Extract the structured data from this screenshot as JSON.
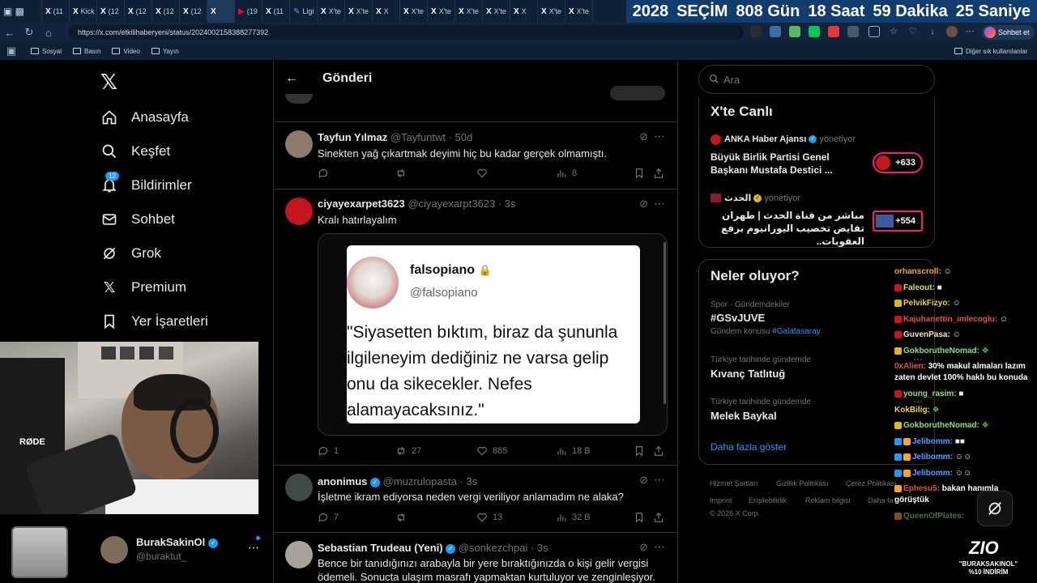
{
  "browser": {
    "tabs": [
      {
        "favicon": "x-icon",
        "label": "(11"
      },
      {
        "favicon": "x-icon",
        "label": "Kick"
      },
      {
        "favicon": "x-icon",
        "label": "(12"
      },
      {
        "favicon": "x-icon",
        "label": "(12"
      },
      {
        "favicon": "x-icon",
        "label": "(12"
      },
      {
        "favicon": "x-icon",
        "label": "(12"
      },
      {
        "favicon": "x-icon",
        "label": ""
      },
      {
        "favicon": "youtube-icon",
        "label": "(19"
      },
      {
        "favicon": "x-icon",
        "label": "(11"
      },
      {
        "favicon": "pen-icon",
        "label": "Ligi"
      },
      {
        "favicon": "x-icon",
        "label": "X'te"
      },
      {
        "favicon": "x-icon",
        "label": "X'te"
      },
      {
        "favicon": "x-icon",
        "label": "X"
      },
      {
        "favicon": "x-icon",
        "label": "X'te"
      },
      {
        "favicon": "x-icon",
        "label": "X'te"
      },
      {
        "favicon": "x-icon",
        "label": "X'te"
      },
      {
        "favicon": "x-icon",
        "label": "X'te"
      },
      {
        "favicon": "x-icon",
        "label": "X"
      },
      {
        "favicon": "x-icon",
        "label": "X'te"
      },
      {
        "favicon": "x-icon",
        "label": "X'te"
      }
    ],
    "url": "https://x.com/etkilihaberyeni/status/2024002158388277392",
    "profile_button": "Sohbet et",
    "bookmarks": [
      "Sosyal",
      "Basın",
      "Video",
      "Yayın"
    ],
    "other_bookmarks": "Diğer sık kullanılanlar"
  },
  "countdown": {
    "year": "2028",
    "label": "SEÇİM",
    "days": "808 Gün",
    "hours": "18 Saat",
    "minutes": "59 Dakika",
    "seconds": "25 Saniye"
  },
  "sidebar": {
    "logo": "x-logo-icon",
    "items": [
      {
        "label": "Anasayfa",
        "icon": "home-icon"
      },
      {
        "label": "Keşfet",
        "icon": "search-icon"
      },
      {
        "label": "Bildirimler",
        "icon": "bell-icon",
        "badge": "12"
      },
      {
        "label": "Sohbet",
        "icon": "mail-icon"
      },
      {
        "label": "Grok",
        "icon": "grok-icon"
      },
      {
        "label": "Premium",
        "icon": "x-premium-icon"
      },
      {
        "label": "Yer İşaretleri",
        "icon": "bookmark-icon"
      }
    ],
    "account": {
      "name": "BurakSakinOl",
      "handle": "@buraktut_"
    }
  },
  "post_header": {
    "title": "Gönderi"
  },
  "tweets": [
    {
      "name": "Tayfun Yılmaz",
      "handle": "@Tayfuntwt",
      "time": "· 50d",
      "text": "Sinekten yağ çıkartmak deyimi hiç bu kadar gerçek olmamıştı.",
      "replies": "",
      "retweets": "",
      "likes": "",
      "views": "8"
    },
    {
      "name": "ciyayexarpet3623",
      "handle": "@ciyayexarpt3623",
      "time": "· 3s",
      "text": "Kralı hatırlayalım",
      "replies": "1",
      "retweets": "27",
      "likes": "885",
      "views": "18 B",
      "quote": {
        "name": "falsopiano",
        "handle": "@falsopiano",
        "text": "\"Siyasetten bıktım, biraz da şununla ilgileneyim dediğiniz ne varsa gelip onu da sikecekler. Nefes alamayacaksınız.\""
      }
    },
    {
      "name": "anonimus",
      "handle": "@muzrulopasta",
      "time": "· 3s",
      "text": "İşletme ikram ediyorsa neden vergi veriliyor anlamadım ne alaka?",
      "replies": "7",
      "retweets": "",
      "likes": "13",
      "views": "32 B"
    },
    {
      "name": "Sebastian Trudeau (Yeni)",
      "handle": "@sonkezchpai",
      "time": "· 3s",
      "text": "Bence bir tanıdığınızı arabayla bir yere bıraktığınızda o kişi gelir vergisi ödemeli. Sonucta ulaşım masrafı yapmaktan kurtuluyor ve zenginleşiyor."
    }
  ],
  "search": {
    "placeholder": "Ara"
  },
  "live": {
    "title": "X'te Canlı",
    "items": [
      {
        "host": "ANKA Haber Ajansı",
        "role": "yönetiyor",
        "text": "Büyük Birlik Partisi Genel Başkanı Mustafa Destici ...",
        "count": "+633"
      },
      {
        "host": "الحدث",
        "role": "yönetiyor",
        "text": "مباشر من قناة الحدث | طهران تقايض تخصيب اليورانيوم برفع العقوبات..",
        "count": "+554"
      }
    ]
  },
  "trends": {
    "title": "Neler oluyor?",
    "items": [
      {
        "meta": "Spor · Gündemdekiler",
        "name": "#GSvJUVE",
        "extra_prefix": "Gündem konusu",
        "extra_link": "#Galatasaray"
      },
      {
        "meta": "Türkiye tarihinde gündemde",
        "name": "Kıvanç Tatlıtuğ"
      },
      {
        "meta": "Türkiye tarihinde gündemde",
        "name": "Melek Baykal"
      }
    ],
    "show_more": "Daha fazla göster"
  },
  "footer": {
    "links": [
      "Hizmet Şartları",
      "Gizlilik Politikası",
      "Çerez Politikası",
      "Imprint",
      "Erişilebilirlik",
      "Reklam bilgisi",
      "Daha fa"
    ],
    "copyright": "© 2026 X Corp."
  },
  "chat": [
    {
      "user": "orhanscroll:",
      "msg": ""
    },
    {
      "user": "Faleout:",
      "msg": ""
    },
    {
      "user": "PelvikFizyo:",
      "msg": ""
    },
    {
      "user": "Kajuhanettin_imlecoglu:",
      "msg": ""
    },
    {
      "user": "GuvenPasa:",
      "msg": ""
    },
    {
      "user": "GokboruthеNomad:",
      "msg": ""
    },
    {
      "user": "0xAlien:",
      "msg": "30% makul almaları lazım"
    },
    {
      "user": "",
      "msg": "zaten devlet 100% haklı bu konuda"
    },
    {
      "user": "young_rasim:",
      "msg": ""
    },
    {
      "user": "KokBilig:",
      "msg": ""
    },
    {
      "user": "GokboruthеNomad:",
      "msg": ""
    },
    {
      "user": "Jelibomm:",
      "msg": ""
    },
    {
      "user": "Jelibomm:",
      "msg": ""
    },
    {
      "user": "Jelibomm:",
      "msg": ""
    },
    {
      "user": "Ephesu5:",
      "msg": "bakan hanımla"
    },
    {
      "user": "",
      "msg": "görüştük"
    },
    {
      "user": "QueenOfPlates:",
      "msg": ""
    }
  ],
  "sponsor": {
    "logo": "ZIO",
    "code": "\"BURAKSAKINOL\"",
    "discount": "%10 İNDİRİM"
  },
  "colors": {
    "accent": "#1d9bf0",
    "live": "#f91880",
    "background": "#000000",
    "border": "#2f3336"
  }
}
